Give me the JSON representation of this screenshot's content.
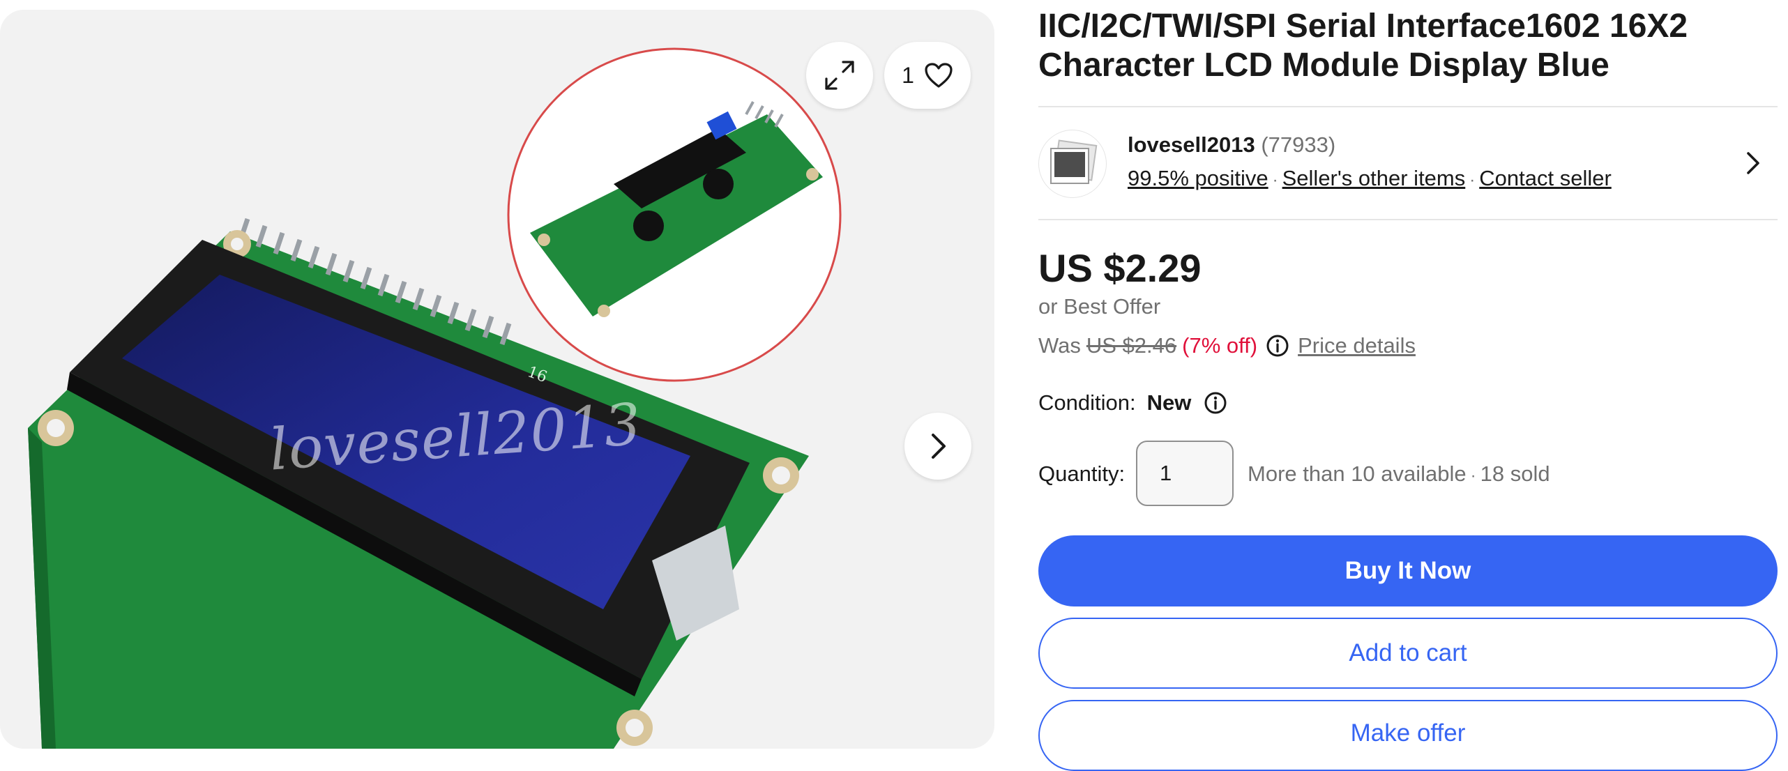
{
  "gallery": {
    "watermark": "lovesell2013",
    "watch_count": "1",
    "board_label": "16",
    "icons": {
      "expand": "expand-icon",
      "heart": "heart-icon",
      "next": "chevron-right-icon"
    }
  },
  "listing": {
    "title": "IIC/I2C/TWI/SPI Serial Interface1602 16X2 Character LCD Module Display Blue"
  },
  "seller": {
    "name": "lovesell2013",
    "feedback_count": "(77933)",
    "positive": "99.5% positive",
    "other_items": "Seller's other items",
    "contact": "Contact seller"
  },
  "price": {
    "current": "US $2.29",
    "best_offer": "or Best Offer",
    "was_label": "Was",
    "was_price": "US $2.46",
    "discount": "(7% off)",
    "details_link": "Price details"
  },
  "condition": {
    "label": "Condition:",
    "value": "New"
  },
  "quantity": {
    "label": "Quantity:",
    "value": "1",
    "available": "More than 10 available",
    "sold": "18 sold"
  },
  "actions": {
    "buy_now": "Buy It Now",
    "add_to_cart": "Add to cart",
    "make_offer": "Make offer"
  },
  "colors": {
    "primary": "#3665f3",
    "discount": "#e0103a",
    "muted": "#707070",
    "lcd_screen": "#1a1f7a",
    "pcb": "#1f8a3c"
  }
}
